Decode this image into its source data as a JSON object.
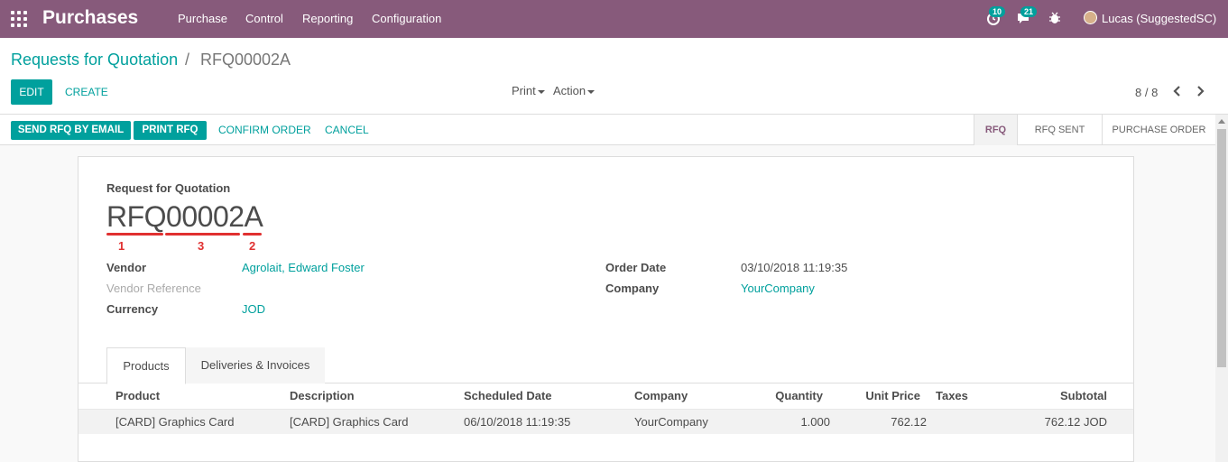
{
  "navbar": {
    "brand": "Purchases",
    "menu": [
      "Purchase",
      "Control",
      "Reporting",
      "Configuration"
    ],
    "activity_count": "10",
    "messages_count": "21",
    "user": "Lucas (SuggestedSC)",
    "color": "#875a7b"
  },
  "breadcrumb": {
    "parent": "Requests for Quotation",
    "sep": "/",
    "current": "RFQ00002A"
  },
  "buttons": {
    "edit": "EDIT",
    "create": "CREATE"
  },
  "dropdowns": {
    "print": "Print",
    "action": "Action"
  },
  "pager": {
    "value": "8 / 8"
  },
  "statusbar": {
    "buttons": [
      "SEND RFQ BY EMAIL",
      "PRINT RFQ"
    ],
    "links": [
      "CONFIRM ORDER",
      "CANCEL"
    ],
    "stages": [
      "RFQ",
      "RFQ SENT",
      "PURCHASE ORDER"
    ],
    "active_stage": "RFQ"
  },
  "form": {
    "doc_label": "Request for Quotation",
    "name": "RFQ00002A",
    "markers": [
      "1",
      "3",
      "2"
    ],
    "fields_left": [
      {
        "label": "Vendor",
        "value": "Agrolait, Edward Foster"
      },
      {
        "label": "Vendor Reference",
        "value": ""
      },
      {
        "label": "Currency",
        "value": "JOD"
      }
    ],
    "fields_right": [
      {
        "label": "Order Date",
        "value": "03/10/2018 11:19:35"
      },
      {
        "label": "Company",
        "value": "YourCompany"
      }
    ]
  },
  "tabs": [
    "Products",
    "Deliveries & Invoices"
  ],
  "table": {
    "headers": [
      "Product",
      "Description",
      "Scheduled Date",
      "Company",
      "Quantity",
      "Unit Price",
      "Taxes",
      "Subtotal"
    ],
    "rows": [
      [
        "[CARD] Graphics Card",
        "[CARD] Graphics Card",
        "06/10/2018 11:19:35",
        "YourCompany",
        "1.000",
        "762.12",
        "",
        "762.12 JOD"
      ]
    ]
  },
  "colors": {
    "accent": "#00a09d",
    "brand": "#875a7b",
    "annotation": "#e03030"
  }
}
